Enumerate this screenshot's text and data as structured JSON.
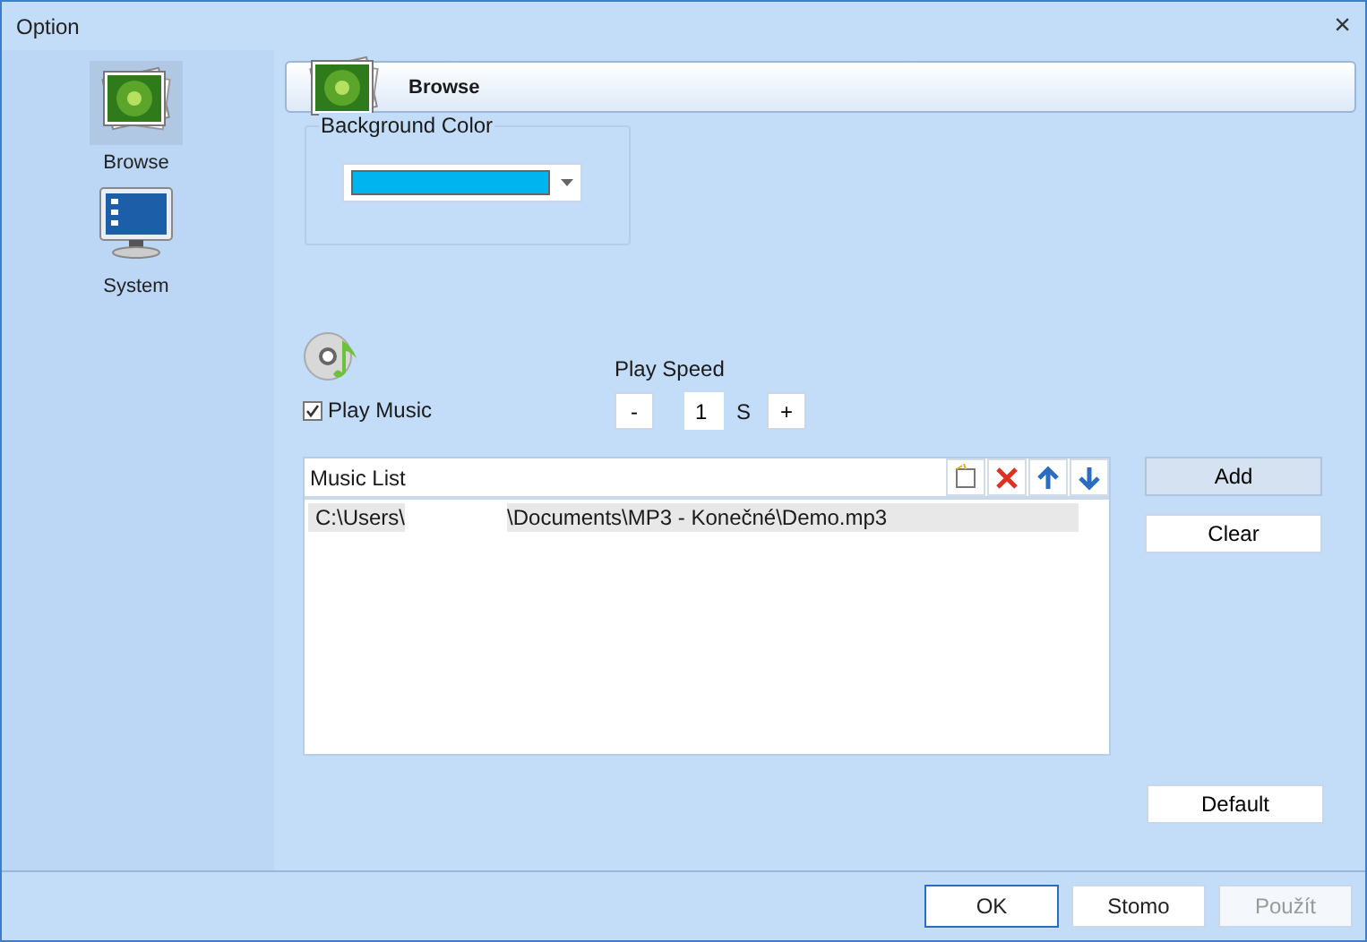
{
  "window": {
    "title": "Option",
    "close": "×"
  },
  "sidebar": {
    "items": [
      {
        "label": "Browse",
        "selected": true
      },
      {
        "label": "System",
        "selected": false
      }
    ]
  },
  "header": {
    "title": "Browse"
  },
  "background_color": {
    "label": "Background Color",
    "color": "#00b4f0"
  },
  "play_music": {
    "label": "Play Music",
    "checked": true
  },
  "play_speed": {
    "label": "Play Speed",
    "minus": "-",
    "value": "1",
    "unit": "S",
    "plus": "+"
  },
  "music_list": {
    "title": "Music List",
    "rows": [
      {
        "path_start": "C:\\Users\\",
        "path_end": "\\Documents\\MP3 - Konečné\\Demo.mp3",
        "selected": true
      }
    ]
  },
  "side_buttons": [
    {
      "label": "Add",
      "highlighted": true
    },
    {
      "label": "Clear",
      "highlighted": false
    }
  ],
  "default_button": "Default",
  "buttons": [
    {
      "label": "OK",
      "default": true,
      "disabled": false
    },
    {
      "label": "Stomo",
      "default": false,
      "disabled": false
    },
    {
      "label": "Použít",
      "default": false,
      "disabled": true
    }
  ]
}
